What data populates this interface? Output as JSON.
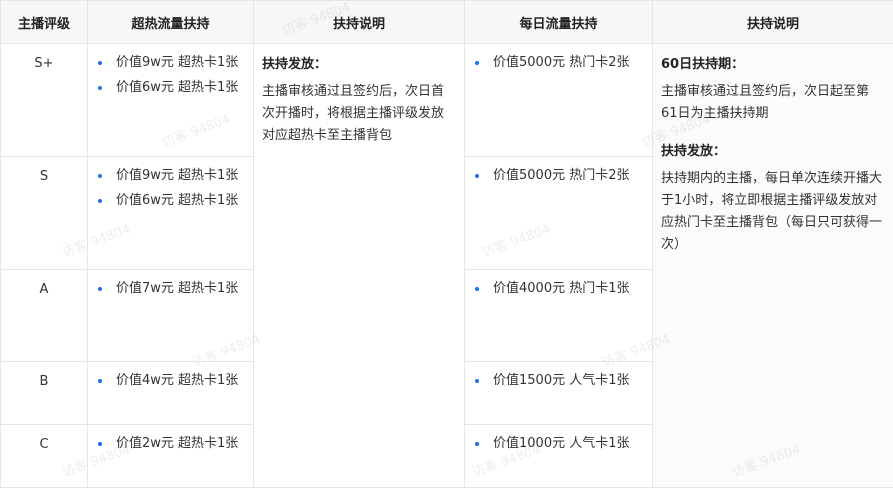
{
  "headers": [
    "主播评级",
    "超热流量扶持",
    "扶持说明",
    "每日流量扶持",
    "扶持说明"
  ],
  "rows": [
    {
      "grade": "S+",
      "hot": [
        "价值9w元 超热卡1张",
        "价值6w元 超热卡1张"
      ],
      "daily": [
        "价值5000元 热门卡2张"
      ]
    },
    {
      "grade": "S",
      "hot": [
        "价值9w元 超热卡1张",
        "价值6w元 超热卡1张"
      ],
      "daily": [
        "价值5000元 热门卡2张"
      ]
    },
    {
      "grade": "A",
      "hot": [
        "价值7w元 超热卡1张"
      ],
      "daily": [
        "价值4000元 热门卡1张"
      ]
    },
    {
      "grade": "B",
      "hot": [
        "价值4w元 超热卡1张"
      ],
      "daily": [
        "价值1500元 人气卡1张"
      ]
    },
    {
      "grade": "C",
      "hot": [
        "价值2w元 超热卡1张"
      ],
      "daily": [
        "价值1000元 人气卡1张"
      ]
    }
  ],
  "desc1": {
    "title": "扶持发放：",
    "text": "主播审核通过且签约后，次日首次开播时，将根据主播评级发放对应超热卡至主播背包"
  },
  "desc2": {
    "title1": "60日扶持期：",
    "text1": "主播审核通过且签约后，次日起至第61日为主播扶持期",
    "title2": "扶持发放：",
    "text2": "扶持期内的主播，每日单次连续开播大于1小时，将立即根据主播评级发放对应热门卡至主播背包（每日只可获得一次）"
  },
  "watermark": "访客 94804"
}
